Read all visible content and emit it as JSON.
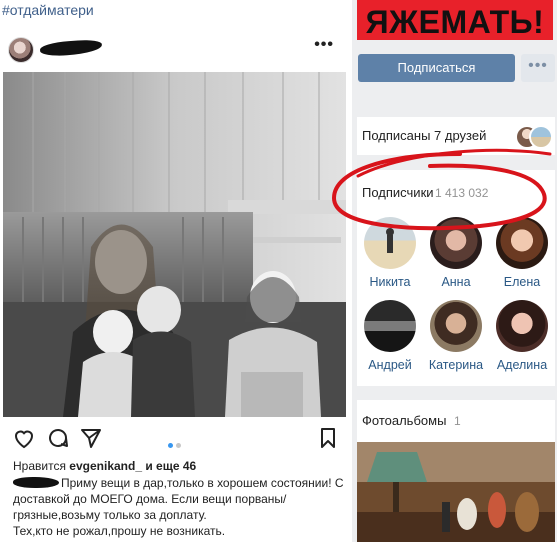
{
  "hashtag": "#отдайматери",
  "post": {
    "more_icon": "ellipsis-icon",
    "likes": {
      "prefix": "Нравится",
      "user": "evgenikand_",
      "suffix": "и еще 46"
    },
    "caption": {
      "line1": "Приму вещи в дар,только в хорошем состоянии! С доставкой до МОЕГО дома. Если вещи порваны/ грязные,возьму только за доплату.",
      "line2": "Тех,кто не рожал,прошу не возникать."
    },
    "icons": [
      "heart-icon",
      "comment-icon",
      "share-icon",
      "bookmark-icon"
    ]
  },
  "sidebar": {
    "banner": "ЯЖЕМАТЬ!",
    "subscribe_label": "Подписаться",
    "more_label": "•••",
    "friends": {
      "label": "Подписаны 7 друзей"
    },
    "subscribers": {
      "label": "Подписчики",
      "count": "1 413 032",
      "people": [
        {
          "name": "Никита"
        },
        {
          "name": "Анна"
        },
        {
          "name": "Елена"
        },
        {
          "name": "Андрей"
        },
        {
          "name": "Катерина"
        },
        {
          "name": "Аделина"
        }
      ]
    },
    "albums": {
      "label": "Фотоальбомы",
      "count": "1"
    }
  },
  "colors": {
    "banner_red": "#e8212a",
    "vk_button": "#5e81a8",
    "vk_link": "#2a5885",
    "annotation_red": "#d8141b",
    "instagram_blue": "#3897f0"
  }
}
